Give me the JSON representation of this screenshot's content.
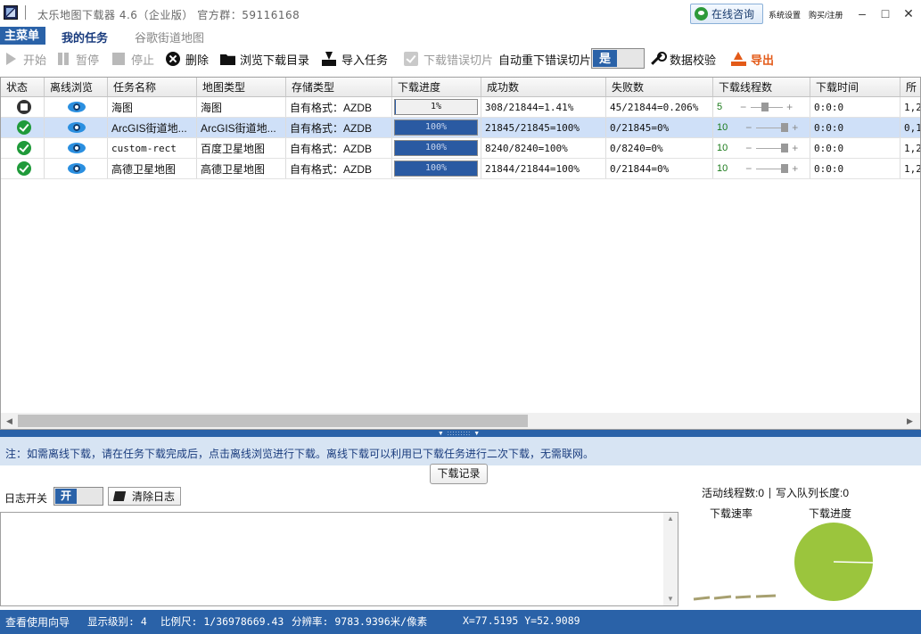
{
  "window": {
    "title": "太乐地图下载器 4.6（企业版） 官方群：59116168",
    "consult_label": "在线咨询",
    "settings_label": "系统设置",
    "buy_label": "购买/注册"
  },
  "menu": {
    "main_label": "主菜单",
    "tabs": [
      {
        "label": "我的任务",
        "active": true
      },
      {
        "label": "谷歌街道地图",
        "active": false
      }
    ]
  },
  "toolbar": {
    "start_label": "开始",
    "pause_label": "暂停",
    "stop_label": "停止",
    "delete_label": "删除",
    "browse_label": "浏览下载目录",
    "import_label": "导入任务",
    "errtiles_label": "下载错误切片",
    "auto_retry_label": "自动重下错误切片",
    "auto_retry_value": "是",
    "verify_label": "数据校验",
    "export_label": "导出",
    "accent_color": "#2a62a8",
    "export_color": "#e35a18"
  },
  "grid": {
    "columns": [
      "状态",
      "离线浏览",
      "任务名称",
      "地图类型",
      "存储类型",
      "下载进度",
      "成功数",
      "失败数",
      "下载线程数",
      "下载时间",
      "所"
    ],
    "rows": [
      {
        "status": "stopped",
        "name": "海图",
        "map_type": "海图",
        "storage": "自有格式：AZDB",
        "progress": 0.0141,
        "progress_label": "1%",
        "success": "308/21844=1.41%",
        "fail": "45/21844=0.206%",
        "threads": "5",
        "threads_level": 0.55,
        "time": "0:0:0",
        "extra": "1,2",
        "selected": false
      },
      {
        "status": "done",
        "name": "ArcGIS街道地...",
        "map_type": "ArcGIS街道地...",
        "storage": "自有格式：AZDB",
        "progress": 1.0,
        "progress_label": "100%",
        "success": "21845/21845=100%",
        "fail": "0/21845=0%",
        "threads": "10",
        "threads_level": 1.0,
        "time": "0:0:0",
        "extra": "0,1",
        "selected": true
      },
      {
        "status": "done",
        "name": "custom-rect",
        "map_type": "百度卫星地图",
        "storage": "自有格式：AZDB",
        "progress": 1.0,
        "progress_label": "100%",
        "success": "8240/8240=100%",
        "fail": "0/8240=0%",
        "threads": "10",
        "threads_level": 1.0,
        "time": "0:0:0",
        "extra": "1,2",
        "selected": false
      },
      {
        "status": "done",
        "name": "高德卫星地图",
        "map_type": "高德卫星地图",
        "storage": "自有格式：AZDB",
        "progress": 1.0,
        "progress_label": "100%",
        "success": "21844/21844=100%",
        "fail": "0/21844=0%",
        "threads": "10",
        "threads_level": 1.0,
        "time": "0:0:0",
        "extra": "1,2",
        "selected": false
      }
    ]
  },
  "note": "注：如需离线下载，请在任务下载完成后，点击离线浏览进行下载。离线下载可以利用已下载任务进行二次下载，无需联网。",
  "log": {
    "tab_label": "下载记录",
    "switch_label": "日志开关",
    "switch_value": "开",
    "clear_label": "清除日志"
  },
  "stats": {
    "active_threads": "活动线程数:0",
    "queue_length": "写入队列长度:0",
    "rate_title": "下载速率",
    "progress_title": "下载进度",
    "pie_color": "#9bc53d"
  },
  "statusbar": {
    "guide": "查看使用向导",
    "level": "显示级别: 4",
    "scale": "比例尺: 1/36978669.43",
    "resolution": "分辨率: 9783.9396米/像素",
    "coords": "X=77.5195 Y=52.9089"
  }
}
